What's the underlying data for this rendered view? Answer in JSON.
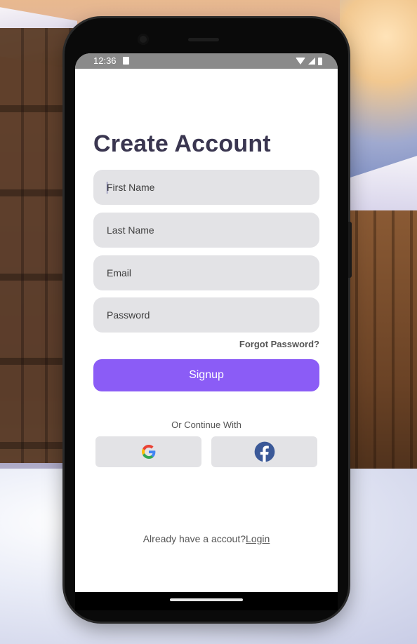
{
  "status_bar": {
    "time": "12:36",
    "icons": [
      "sim-card-icon",
      "wifi-icon",
      "signal-icon",
      "battery-icon"
    ]
  },
  "form": {
    "title": "Create Account",
    "first_name_placeholder": "First Name",
    "last_name_placeholder": "Last Name",
    "email_placeholder": "Email",
    "password_placeholder": "Password",
    "forgot_password": "Forgot Password?",
    "signup_label": "Signup"
  },
  "social": {
    "divider_text": "Or Continue With",
    "providers": [
      "google-icon",
      "facebook-icon"
    ]
  },
  "footer": {
    "prompt": "Already have a accout?",
    "login_label": "Login"
  },
  "colors": {
    "primary": "#8b5cf6",
    "title": "#3a3650",
    "field_bg": "#e3e3e6",
    "facebook": "#1877f2"
  }
}
